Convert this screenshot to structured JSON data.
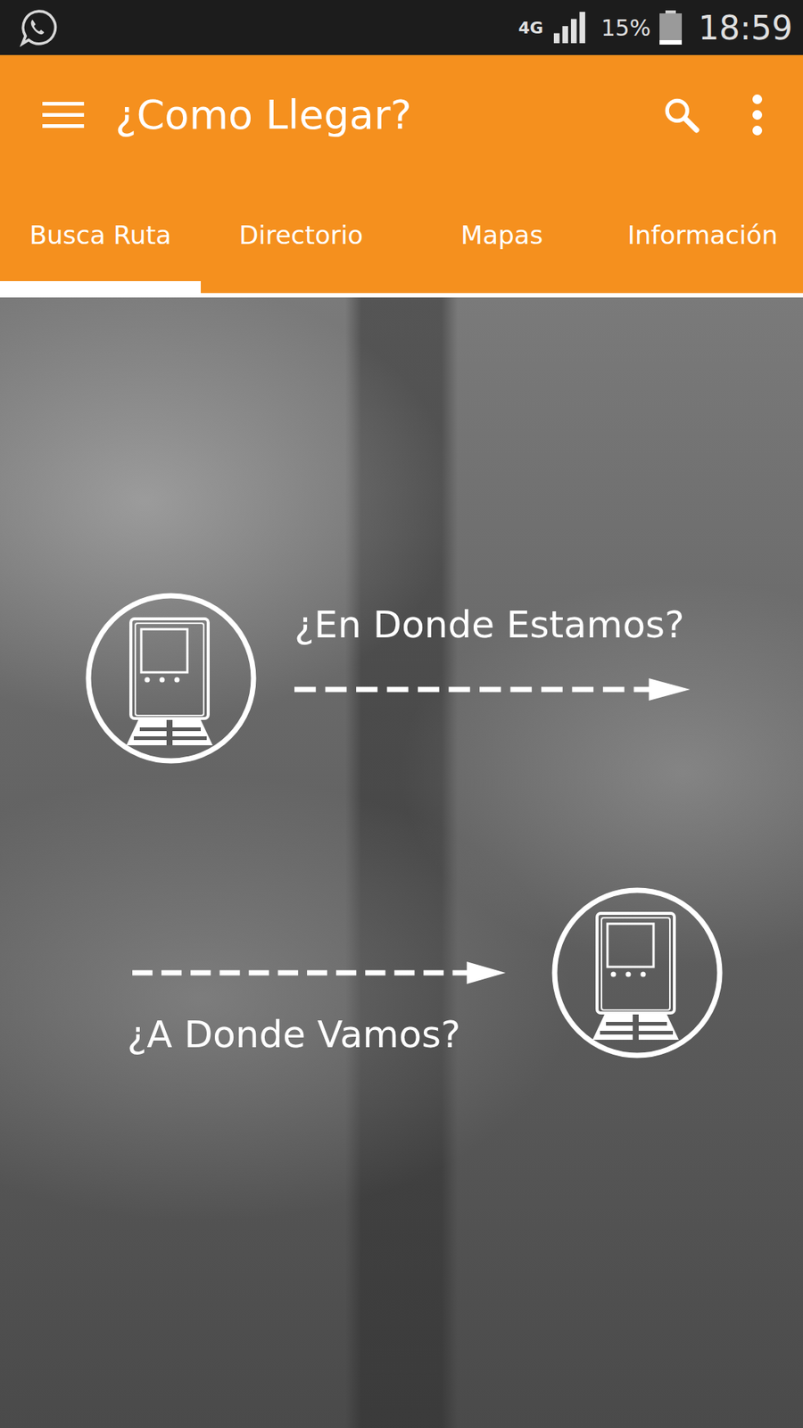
{
  "status_bar": {
    "network": "4G",
    "battery": "15%",
    "battery_level": 0.15,
    "time": "18:59"
  },
  "app_bar": {
    "title": "¿Como Llegar?"
  },
  "tabs": [
    {
      "label": "Busca Ruta",
      "selected": true
    },
    {
      "label": "Directorio",
      "selected": false
    },
    {
      "label": "Mapas",
      "selected": false
    },
    {
      "label": "Información",
      "selected": false
    }
  ],
  "route_steps": [
    {
      "kind": "origin",
      "label": "¿En Donde Estamos?"
    },
    {
      "kind": "destination",
      "label": "¿A Donde Vamos?"
    }
  ]
}
